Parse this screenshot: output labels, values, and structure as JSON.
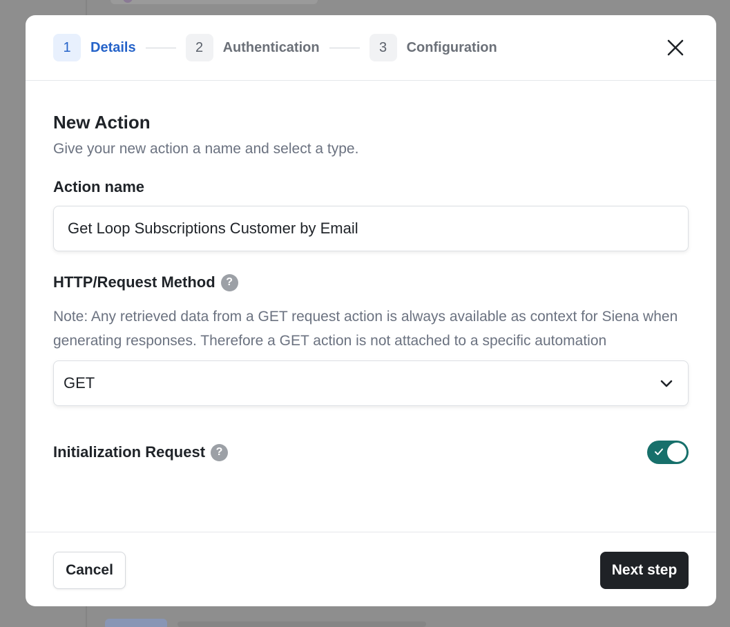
{
  "stepper": {
    "steps": [
      {
        "num": "1",
        "label": "Details"
      },
      {
        "num": "2",
        "label": "Authentication"
      },
      {
        "num": "3",
        "label": "Configuration"
      }
    ],
    "active_step": 1
  },
  "modal": {
    "title": "New Action",
    "subtitle": "Give your new action a name and select a type."
  },
  "action_name": {
    "label": "Action name",
    "value": "Get Loop Subscriptions Customer by Email"
  },
  "http_method": {
    "label": "HTTP/Request Method",
    "note": "Note: Any retrieved data from a GET request action is always available as context for Siena when generating responses. Therefore a GET action is not attached to a specific automation",
    "selected": "GET"
  },
  "initialization": {
    "label": "Initialization Request",
    "enabled": true
  },
  "footer": {
    "cancel_label": "Cancel",
    "next_label": "Next step"
  },
  "icons": {
    "close": "close-icon",
    "help": "help-icon",
    "chevron": "chevron-down-icon",
    "check": "check-icon"
  },
  "colors": {
    "accent": "#2563c9",
    "toggle_on": "#17706b",
    "primary_button": "#1f2226"
  }
}
